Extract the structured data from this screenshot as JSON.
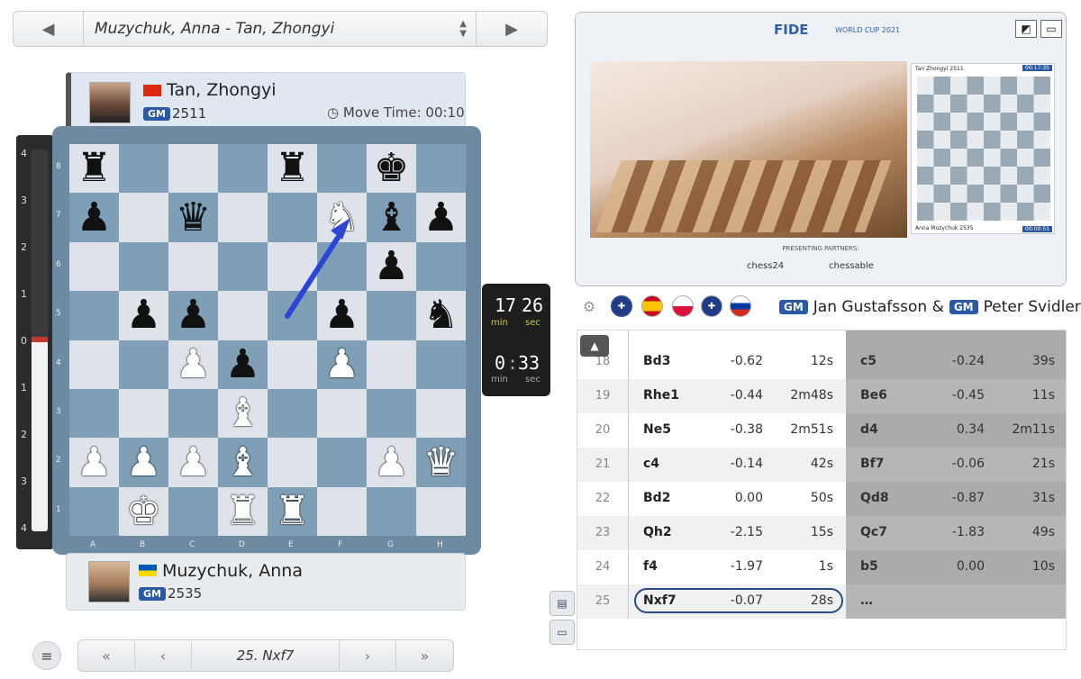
{
  "game_selector": {
    "title": "Muzychuk, Anna - Tan, Zhongyi",
    "prev": "◀",
    "next": "▶"
  },
  "top_player": {
    "name": "Tan, Zhongyi",
    "title": "GM",
    "rating": "2511",
    "move_time_label": "Move Time: 00:10",
    "flag_color": "#de2910"
  },
  "bottom_player": {
    "name": "Muzychuk, Anna",
    "title": "GM",
    "rating": "2535",
    "flag_color": "#0057b7"
  },
  "eval_bar": {
    "labels": [
      "4",
      "3",
      "2",
      "1",
      "0",
      "1",
      "2",
      "3",
      "4"
    ]
  },
  "board": {
    "ranks": [
      "8",
      "7",
      "6",
      "5",
      "4",
      "3",
      "2",
      "1"
    ],
    "files": [
      "A",
      "B",
      "C",
      "D",
      "E",
      "F",
      "G",
      "H"
    ],
    "position": [
      [
        "bR",
        "",
        "",
        "",
        "bR",
        "",
        "bK",
        ""
      ],
      [
        "bP",
        "",
        "bQ",
        "",
        "",
        "wN",
        "bB",
        "bP"
      ],
      [
        "",
        "",
        "",
        "",
        "",
        "",
        "bP",
        ""
      ],
      [
        "",
        "bP",
        "bP",
        "",
        "",
        "bP",
        "",
        "bN"
      ],
      [
        "",
        "",
        "wP",
        "bP",
        "",
        "wP",
        "",
        ""
      ],
      [
        "",
        "",
        "",
        "wB",
        "",
        "",
        "",
        ""
      ],
      [
        "wP",
        "wP",
        "wP",
        "wB",
        "",
        "",
        "wP",
        "wQ"
      ],
      [
        "",
        "wK",
        "",
        "wR",
        "wR",
        "",
        "",
        ""
      ]
    ],
    "last_move": "e5-f7"
  },
  "clocks": {
    "top": {
      "min": "17",
      "sec": "26"
    },
    "bottom": {
      "min": "0",
      "sec": "33"
    },
    "min_label": "min",
    "sec_label": "sec"
  },
  "nav": {
    "current_move": "25. Nxf7",
    "first": "«",
    "back": "‹",
    "forward": "›",
    "last": "»",
    "menu": "≡"
  },
  "video": {
    "event": "FIDE",
    "event_sub": "WORLD CUP 2021",
    "partners_label": "PRESENTING PARTNERS:",
    "partners": [
      "chess24",
      "chessable"
    ],
    "mini_top_player": "Tan Zhongyi 2511",
    "mini_bottom_player": "Anna Muzychuk 2535",
    "mini_top_clock": "00:17:35",
    "mini_bottom_clock": "00:00:51"
  },
  "commentary": {
    "gm1_title": "GM",
    "gm1_name": "Jan Gustafsson &",
    "gm2_title": "GM",
    "gm2_name": "Peter Svidler",
    "languages": [
      "English",
      "Spanish",
      "Polish",
      "English",
      "Russian"
    ]
  },
  "moves": [
    {
      "n": "18",
      "w": "Bd3",
      "we": "-0.62",
      "wt": "12s",
      "b": "c5",
      "be": "-0.24",
      "bt": "39s"
    },
    {
      "n": "19",
      "w": "Rhe1",
      "we": "-0.44",
      "wt": "2m48s",
      "b": "Be6",
      "be": "-0.45",
      "bt": "11s"
    },
    {
      "n": "20",
      "w": "Ne5",
      "we": "-0.38",
      "wt": "2m51s",
      "b": "d4",
      "be": "0.34",
      "bt": "2m11s"
    },
    {
      "n": "21",
      "w": "c4",
      "we": "-0.14",
      "wt": "42s",
      "b": "Bf7",
      "be": "-0.06",
      "bt": "21s"
    },
    {
      "n": "22",
      "w": "Bd2",
      "we": "0.00",
      "wt": "50s",
      "b": "Qd8",
      "be": "-0.87",
      "bt": "31s"
    },
    {
      "n": "23",
      "w": "Qh2",
      "we": "-2.15",
      "wt": "15s",
      "b": "Qc7",
      "be": "-1.83",
      "bt": "49s"
    },
    {
      "n": "24",
      "w": "f4",
      "we": "-1.97",
      "wt": "1s",
      "b": "b5",
      "be": "0.00",
      "bt": "10s"
    },
    {
      "n": "25",
      "w": "Nxf7",
      "we": "-0.07",
      "wt": "28s",
      "b": "…",
      "be": "",
      "bt": ""
    }
  ]
}
